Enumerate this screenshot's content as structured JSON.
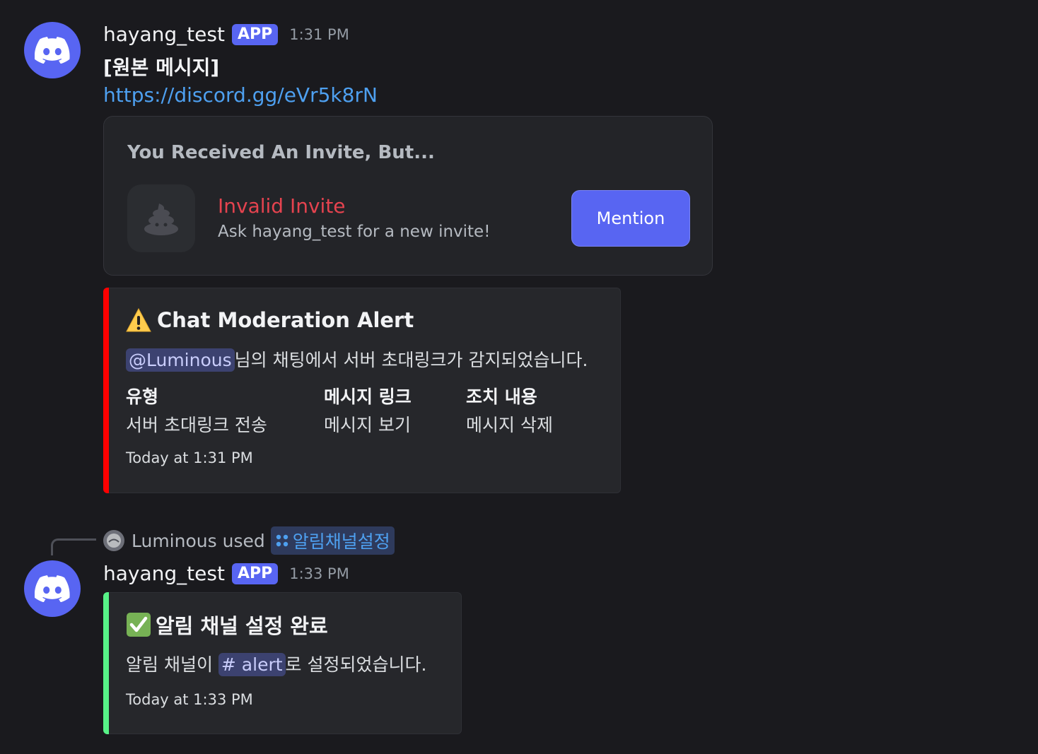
{
  "messages": [
    {
      "username": "hayang_test",
      "badge": "APP",
      "time": "1:31 PM",
      "text": "[원본 메시지]",
      "link": "https://discord.gg/eVr5k8rN",
      "invite": {
        "title": "You Received An Invite, But...",
        "name": "Invalid Invite",
        "subtitle": "Ask hayang_test for a new invite!",
        "button": "Mention"
      },
      "embed": {
        "color": "#ff0000",
        "title": "Chat Moderation Alert",
        "title_icon": "warning-icon",
        "mention": "@Luminous",
        "description": "님의 채팅에서 서버 초대링크가 감지되었습니다.",
        "fields": [
          {
            "name": "유형",
            "value": "서버 초대링크 전송",
            "is_link": false
          },
          {
            "name": "메시지 링크",
            "value": "메시지 보기",
            "is_link": true
          },
          {
            "name": "조치 내용",
            "value": "메시지 삭제",
            "is_link": false
          }
        ],
        "footer": "Today at 1:31 PM"
      }
    },
    {
      "interaction": {
        "user": "Luminous",
        "used_label": "used",
        "command": "알림채널설정",
        "command_icon": "slash-command-icon"
      },
      "username": "hayang_test",
      "badge": "APP",
      "time": "1:33 PM",
      "embed": {
        "color": "#57f287",
        "title": "알림 채널 설정 완료",
        "title_icon": "check-icon",
        "desc_prefix": "알림 채널이 ",
        "channel": "# alert",
        "desc_suffix": "로 설정되었습니다.",
        "footer": "Today at 1:33 PM"
      }
    }
  ]
}
